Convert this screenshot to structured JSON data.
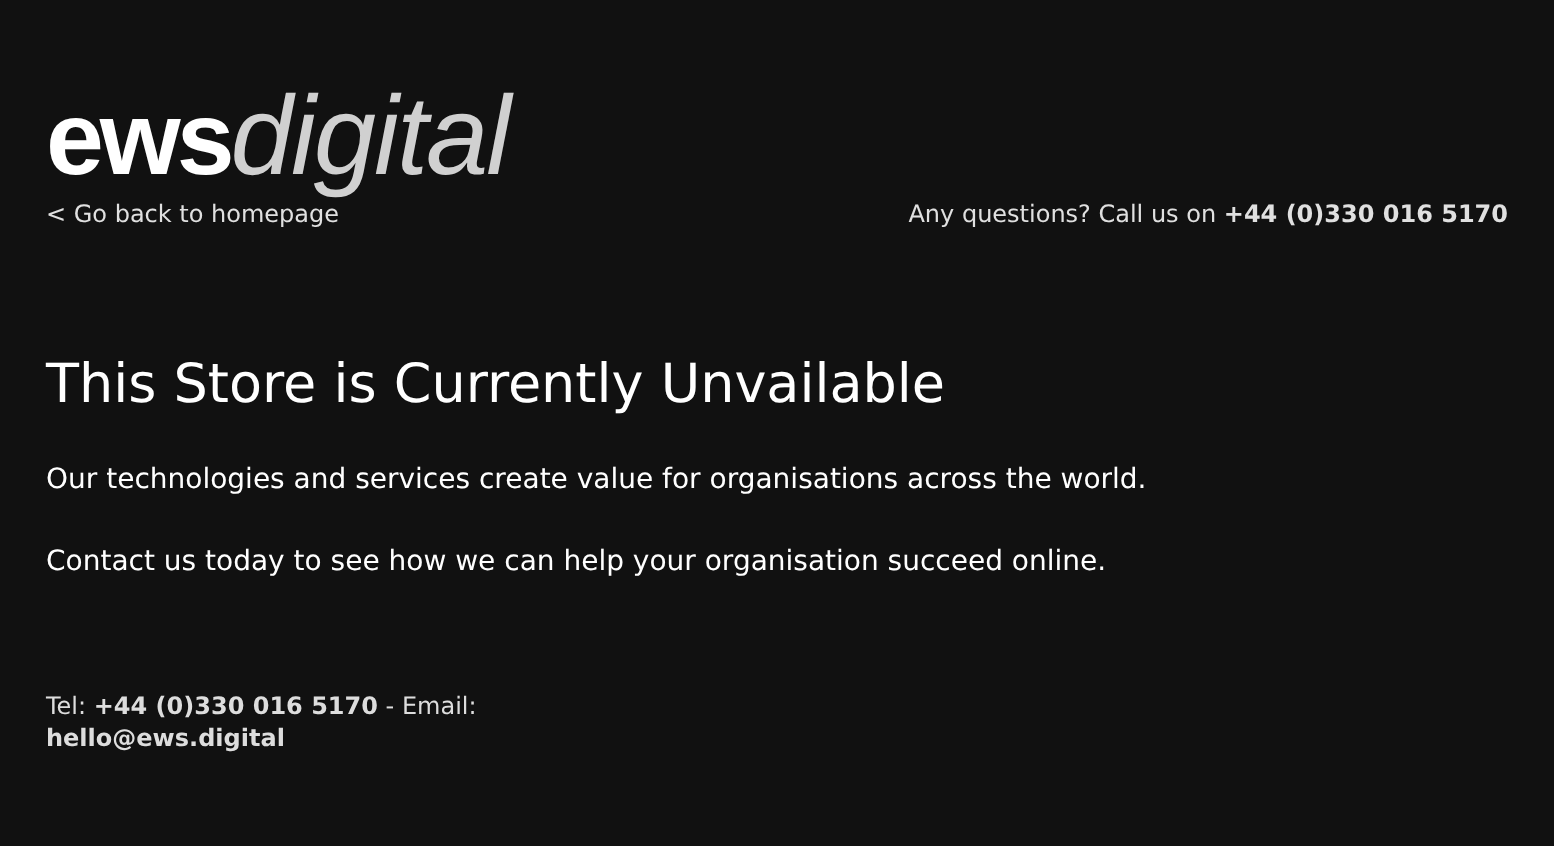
{
  "logo": {
    "bold": "ews",
    "styled": "digital"
  },
  "back_link": "< Go back to homepage",
  "contact_header": "Any questions? Call us on **+44 (0)330 016 5170**",
  "heading": "This Store is Currently Unvailable",
  "paragraphs": [
    "Our technologies and services create value for organisations across the world.",
    "Contact us today to see how we can help your organisation succeed online."
  ],
  "footer": "Tel: **+44 (0)330 016 5170** - Email: **hello@ews.digital**"
}
